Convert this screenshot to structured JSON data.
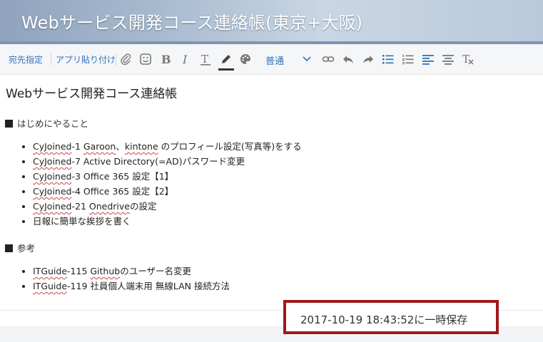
{
  "header": {
    "title": "Webサービス開発コース連絡帳(東京+大阪)"
  },
  "toolbar": {
    "recipient_label": "宛先指定",
    "app_paste_label": "アプリ貼り付け",
    "format_select": {
      "value": "普通"
    },
    "icons": [
      "paperclip-icon",
      "emoji-icon",
      "bold-icon",
      "italic-icon",
      "text-size-icon",
      "pen-icon",
      "palette-icon",
      "link-icon",
      "undo-icon",
      "redo-icon",
      "bullet-list-icon",
      "numbered-list-icon",
      "align-left-icon",
      "align-center-icon",
      "clear-format-icon"
    ],
    "accent_color": "#2f73b8"
  },
  "document": {
    "title": "Webサービス開発コース連絡帳",
    "sections": [
      {
        "heading": "はじめにやること",
        "items": [
          {
            "prefix": "CyJoined",
            "text": "-1 ",
            "kw1": "Garoon",
            "mid": "、",
            "kw2": "kintone",
            "rest": " のプロフィール設定(写真等)をする"
          },
          {
            "prefix": "CyJoined",
            "text": "-7 Active Directory(=AD)パスワード変更"
          },
          {
            "prefix": "CyJoined",
            "text": "-3 Office 365 設定【1】"
          },
          {
            "prefix": "CyJoined",
            "text": "-4 Office 365 設定【2】"
          },
          {
            "prefix": "CyJoined",
            "text": "-21 ",
            "kw1": "Onedrive",
            "rest": "の設定"
          },
          {
            "text": "日報に簡単な挨拶を書く"
          }
        ]
      },
      {
        "heading": "参考",
        "items": [
          {
            "prefix": "ITGuide",
            "text": "-115 ",
            "kw1": "Github",
            "rest": "のユーザー名変更"
          },
          {
            "prefix": "ITGuide",
            "text": "-119 社員個人端末用 無線LAN 接続方法"
          }
        ]
      }
    ]
  },
  "status": {
    "save_message": "2017-10-19 18:43:52に一時保存",
    "highlight_color": "#a0181b"
  }
}
